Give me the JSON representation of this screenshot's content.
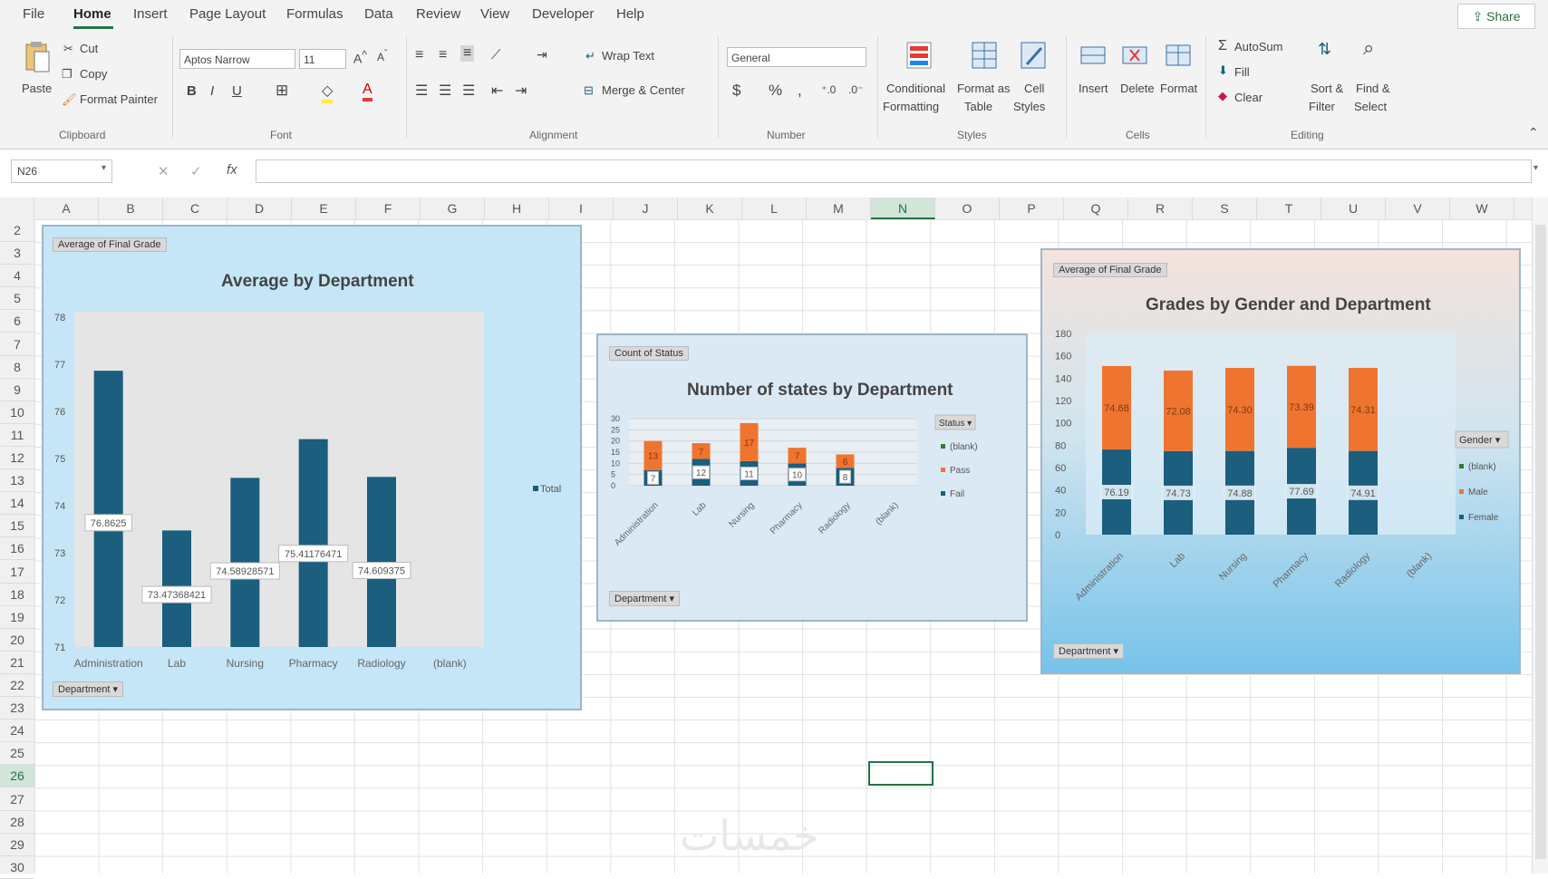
{
  "menu": [
    "File",
    "Home",
    "Insert",
    "Page Layout",
    "Formulas",
    "Data",
    "Review",
    "View",
    "Developer",
    "Help"
  ],
  "share": "Share",
  "ribbon": {
    "clipboard": {
      "paste": "Paste",
      "cut": "Cut",
      "copy": "Copy",
      "format_painter": "Format Painter",
      "label": "Clipboard"
    },
    "font": {
      "name": "Aptos Narrow",
      "size": "11",
      "label": "Font"
    },
    "alignment": {
      "wrap": "Wrap Text",
      "merge": "Merge & Center",
      "label": "Alignment"
    },
    "number": {
      "format": "General",
      "label": "Number"
    },
    "styles": {
      "conditional": [
        "Conditional",
        "Formatting"
      ],
      "format_table": [
        "Format as",
        "Table"
      ],
      "cell_styles": [
        "Cell",
        "Styles"
      ],
      "label": "Styles"
    },
    "cells": {
      "insert": "Insert",
      "delete": "Delete",
      "format": "Format",
      "label": "Cells"
    },
    "editing": {
      "autosum": "AutoSum",
      "fill": "Fill",
      "clear": "Clear",
      "sort": [
        "Sort &",
        "Filter"
      ],
      "find": [
        "Find &",
        "Select"
      ],
      "label": "Editing"
    }
  },
  "namebox": "N26",
  "columns": [
    "A",
    "B",
    "C",
    "D",
    "E",
    "F",
    "G",
    "H",
    "I",
    "J",
    "K",
    "L",
    "M",
    "N",
    "O",
    "P",
    "Q",
    "R",
    "S",
    "T",
    "U",
    "V",
    "W"
  ],
  "rows": [
    "2",
    "3",
    "4",
    "5",
    "6",
    "7",
    "8",
    "9",
    "10",
    "11",
    "12",
    "13",
    "14",
    "15",
    "16",
    "17",
    "18",
    "19",
    "20",
    "21",
    "22",
    "23",
    "24",
    "25",
    "26",
    "27",
    "28",
    "29",
    "30"
  ],
  "watermark": "خمسات",
  "charts": [
    {
      "pill": "Average of Final Grade",
      "filter": "Department",
      "legend": "Total",
      "chart_data": {
        "type": "bar",
        "title": "Average by Department",
        "categories": [
          "Administration",
          "Lab",
          "Nursing",
          "Pharmacy",
          "Radiology",
          "(blank)"
        ],
        "values": [
          76.8625,
          73.47368421,
          74.58928571,
          75.41176471,
          74.609375,
          null
        ],
        "labels": [
          "76.8625",
          "73.47368421",
          "74.58928571",
          "75.41176471",
          "74.609375",
          ""
        ],
        "ylim": [
          71,
          78
        ],
        "yticks": [
          "71",
          "72",
          "73",
          "74",
          "75",
          "76",
          "77",
          "78"
        ],
        "color": "#1b5e7e"
      }
    },
    {
      "pill": "Count of Status",
      "filter": "Department",
      "legend_title": "Status",
      "chart_data": {
        "type": "bar",
        "stacked": true,
        "title": "Number of states by Department",
        "categories": [
          "Administration",
          "Lab",
          "Nursing",
          "Pharmacy",
          "Radiology",
          "(blank)"
        ],
        "series": [
          {
            "name": "(blank)",
            "values": [
              0,
              0,
              0,
              0,
              0,
              0
            ],
            "color": "#2e7d32"
          },
          {
            "name": "Fail",
            "values": [
              7,
              12,
              11,
              10,
              8,
              0
            ],
            "color": "#1b5e7e"
          },
          {
            "name": "Pass",
            "values": [
              13,
              7,
              17,
              7,
              6,
              0
            ],
            "color": "#ef7430"
          }
        ],
        "legend_order": [
          "(blank)",
          "Pass",
          "Fail"
        ],
        "labels_fail": [
          "7",
          "12",
          "11",
          "10",
          "8",
          ""
        ],
        "labels_pass": [
          "13",
          "7",
          "17",
          "7",
          "6",
          ""
        ],
        "ylim": [
          0,
          30
        ],
        "yticks": [
          "0",
          "5",
          "10",
          "15",
          "20",
          "25",
          "30"
        ]
      }
    },
    {
      "pill": "Average of Final Grade",
      "filter": "Department",
      "legend_title": "Gender",
      "chart_data": {
        "type": "bar",
        "stacked": true,
        "title": "Grades by Gender and Department",
        "categories": [
          "Administration",
          "Lab",
          "Nursing",
          "Pharmacy",
          "Radiology",
          "(blank)"
        ],
        "series": [
          {
            "name": "(blank)",
            "values": [
              0,
              0,
              0,
              0,
              0,
              0
            ],
            "color": "#2e7d32"
          },
          {
            "name": "Female",
            "values": [
              76.19,
              74.73,
              74.88,
              77.69,
              74.91,
              0
            ],
            "color": "#1b5e7e"
          },
          {
            "name": "Male",
            "values": [
              74.68,
              72.08,
              74.3,
              73.39,
              74.31,
              0
            ],
            "color": "#ef7430"
          }
        ],
        "legend_order": [
          "(blank)",
          "Male",
          "Female"
        ],
        "labels_female": [
          "76.19",
          "74.73",
          "74.88",
          "77.69",
          "74.91",
          ""
        ],
        "labels_male": [
          "74.68",
          "72.08",
          "74.30",
          "73.39",
          "74.31",
          ""
        ],
        "ylim": [
          0,
          180
        ],
        "yticks": [
          "0",
          "20",
          "40",
          "60",
          "80",
          "100",
          "120",
          "140",
          "160",
          "180"
        ]
      }
    }
  ]
}
